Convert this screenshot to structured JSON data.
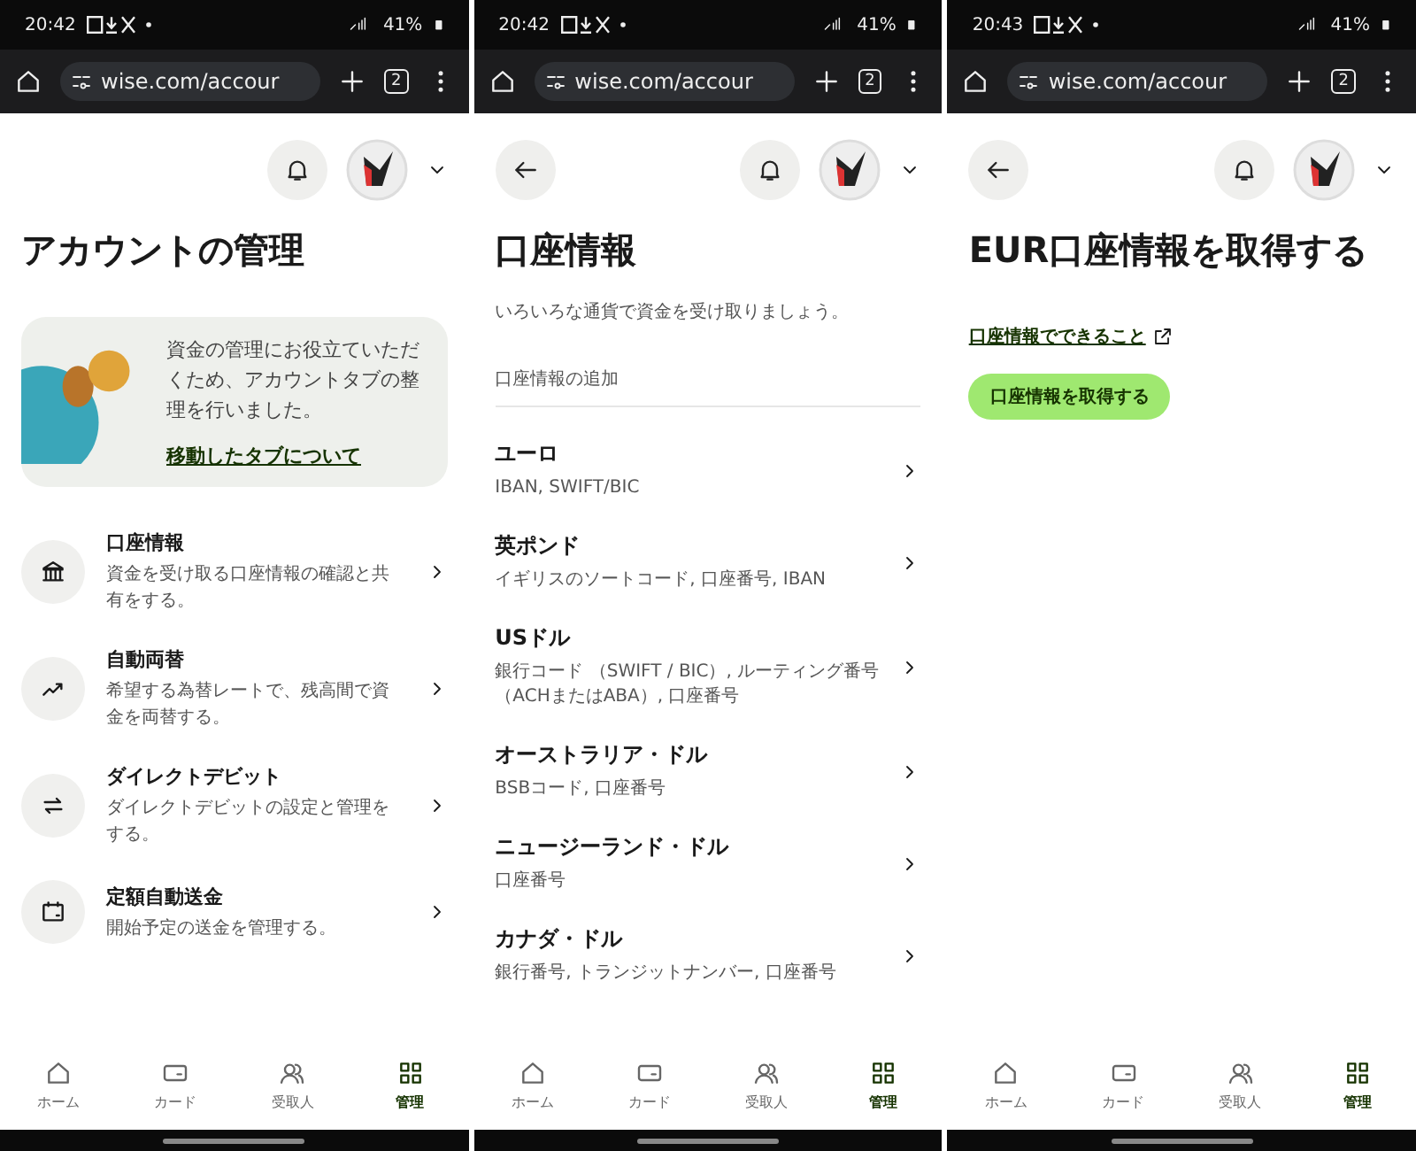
{
  "screens": [
    {
      "kind": "account",
      "status_bar": {
        "time": "20:42",
        "battery": "41%"
      },
      "browser": {
        "url": "wise.com/accour",
        "tab_count": "2"
      },
      "header": {
        "back": false
      },
      "title": "アカウントの管理",
      "promo": {
        "text": "資金の管理にお役立ていただくため、アカウントタブの整理を行いました。",
        "link": "移動したタブについて"
      },
      "items": [
        {
          "title": "口座情報",
          "desc": "資金を受け取る口座情報の確認と共有をする。"
        },
        {
          "title": "自動両替",
          "desc": "希望する為替レートで、残高間で資金を両替する。"
        },
        {
          "title": "ダイレクトデビット",
          "desc": "ダイレクトデビットの設定と管理をする。"
        },
        {
          "title": "定額自動送金",
          "desc": "開始予定の送金を管理する。"
        }
      ],
      "nav": [
        {
          "label": "ホーム",
          "selected": false
        },
        {
          "label": "カード",
          "selected": false
        },
        {
          "label": "受取人",
          "selected": false
        },
        {
          "label": "管理",
          "selected": true
        }
      ]
    },
    {
      "kind": "list",
      "status_bar": {
        "time": "20:42",
        "battery": "41%"
      },
      "browser": {
        "url": "wise.com/accour",
        "tab_count": "2"
      },
      "header": {
        "back": true
      },
      "title": "口座情報",
      "subtitle": "いろいろな通貨で資金を受け取りましょう。",
      "section": "口座情報の追加",
      "items": [
        {
          "name": "ユーロ",
          "detail": "IBAN, SWIFT/BIC"
        },
        {
          "name": "英ポンド",
          "detail": "イギリスのソートコード, 口座番号, IBAN"
        },
        {
          "name": "USドル",
          "detail": "銀行コード （SWIFT / BIC）, ルーティング番号（ACHまたはABA）, 口座番号"
        },
        {
          "name": "オーストラリア・ドル",
          "detail": "BSBコード, 口座番号"
        },
        {
          "name": "ニュージーランド・ドル",
          "detail": "口座番号"
        },
        {
          "name": "カナダ・ドル",
          "detail": "銀行番号, トランジットナンバー, 口座番号"
        }
      ],
      "nav": [
        {
          "label": "ホーム",
          "selected": false
        },
        {
          "label": "カード",
          "selected": false
        },
        {
          "label": "受取人",
          "selected": false
        },
        {
          "label": "管理",
          "selected": true
        }
      ]
    },
    {
      "kind": "get",
      "status_bar": {
        "time": "20:43",
        "battery": "41%"
      },
      "browser": {
        "url": "wise.com/accour",
        "tab_count": "2"
      },
      "header": {
        "back": true
      },
      "title": "EUR口座情報を取得する",
      "link": "口座情報でできること",
      "button": "口座情報を取得する",
      "nav": [
        {
          "label": "ホーム",
          "selected": false
        },
        {
          "label": "カード",
          "selected": false
        },
        {
          "label": "受取人",
          "selected": false
        },
        {
          "label": "管理",
          "selected": true
        }
      ]
    }
  ]
}
